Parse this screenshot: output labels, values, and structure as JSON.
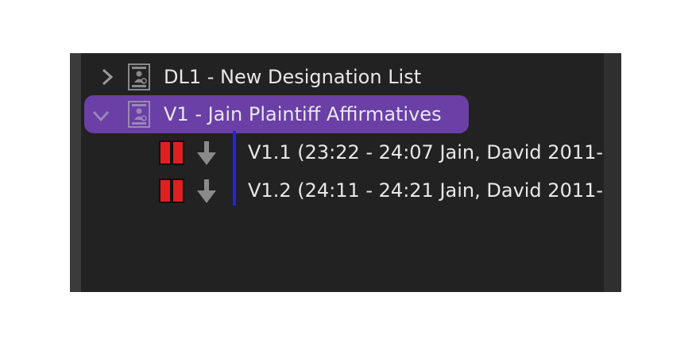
{
  "tree": {
    "items": [
      {
        "label": "DL1 - New Designation List",
        "expanded": false,
        "icon": "document-user-icon",
        "chevron": "chevron-right-icon"
      },
      {
        "label": "V1 - Jain Plaintiff Affirmatives",
        "expanded": true,
        "selected": true,
        "icon": "document-user-icon",
        "chevron": "chevron-down-icon",
        "children": [
          {
            "label": "V1.1 (23:22 - 24:07 Jain, David 2011-",
            "flag_color": "#e02020",
            "icon": "download-arrow-icon"
          },
          {
            "label": "V1.2 (24:11 - 24:21 Jain, David 2011-",
            "flag_color": "#e02020",
            "icon": "download-arrow-icon"
          }
        ]
      }
    ]
  },
  "colors": {
    "panel_bg": "#222222",
    "selected_bg": "#6a3fa6",
    "accent_bar": "#2323e6",
    "flag": "#e02020",
    "text": "#e8e8e8",
    "icon_gray": "#8a8a8a"
  }
}
